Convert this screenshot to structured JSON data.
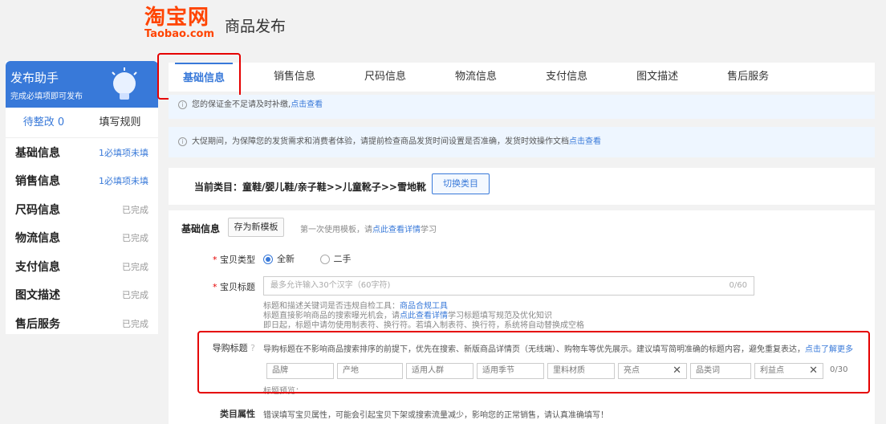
{
  "header": {
    "logo_main": "淘宝网",
    "logo_sub": "Taobao.com",
    "title": "商品发布"
  },
  "sidebar": {
    "title": "发布助手",
    "subtitle": "完成必填项即可发布",
    "icon": "lightbulb-icon",
    "tabs": [
      {
        "label": "待整改 0"
      },
      {
        "label": "填写规则"
      }
    ],
    "items": [
      {
        "label": "基础信息",
        "status": "1必填项未填"
      },
      {
        "label": "销售信息",
        "status": "1必填项未填"
      },
      {
        "label": "尺码信息",
        "status": "已完成"
      },
      {
        "label": "物流信息",
        "status": "已完成"
      },
      {
        "label": "支付信息",
        "status": "已完成"
      },
      {
        "label": "图文描述",
        "status": "已完成"
      },
      {
        "label": "售后服务",
        "status": "已完成"
      }
    ]
  },
  "main_tabs": [
    {
      "label": "基础信息"
    },
    {
      "label": "销售信息"
    },
    {
      "label": "尺码信息"
    },
    {
      "label": "物流信息"
    },
    {
      "label": "支付信息"
    },
    {
      "label": "图文描述"
    },
    {
      "label": "售后服务"
    }
  ],
  "notices": {
    "n1_text": "您的保证金不足请及时补缴,",
    "n1_link": "点击查看",
    "n2_text": "大促期间，为保障您的发货需求和消费者体验，请提前检查商品发货时间设置是否准确，发货时效操作文档",
    "n2_link": "点击查看"
  },
  "category": {
    "label": "当前类目：童鞋/婴儿鞋/亲子鞋>>儿童靴子>>雪地靴",
    "switch_button": "切换类目"
  },
  "form": {
    "section_title": "基础信息",
    "save_template_button": "存为新模板",
    "template_tip_prefix": "第一次使用模板，请",
    "template_tip_link": "点此查看详情",
    "template_tip_suffix": "学习",
    "type_label": "宝贝类型",
    "type_options": [
      "全新",
      "二手"
    ],
    "title_label": "宝贝标题",
    "title_placeholder": "最多允许输入30个汉字（60字符)",
    "title_count": "0/60",
    "title_help1_prefix": "标题和描述关键词是否违规自检工具：",
    "title_help1_link": "商品合规工具",
    "title_help2_prefix": "标题直接影响商品的搜索曝光机会，请",
    "title_help2_link": "点此查看详情",
    "title_help2_suffix": "学习标题填写规范及优化知识",
    "title_help3": "即日起，标题中请勿使用制表符、换行符。若填入制表符、换行符，系统将自动替换成空格",
    "guide_label": "导购标题",
    "guide_desc": "导购标题在不影响商品搜索排序的前提下，优先在搜索、新版商品详情页（无线端）、购物车等优先展示。建议填写简明准确的标题内容，避免重复表达，",
    "guide_link": "点击了解更多",
    "guide_keywords": [
      "品牌",
      "产地",
      "适用人群",
      "适用季节",
      "里料材质",
      "亮点",
      "品类词",
      "利益点"
    ],
    "guide_count": "0/30",
    "guide_preview": "标题预览：",
    "attr_label": "类目属性",
    "attr_desc": "错误填写宝贝属性，可能会引起宝贝下架或搜索流量减少，影响您的正常销售，请认真准确填写！"
  },
  "colors": {
    "brand": "#ff4400",
    "accent": "#3879d9",
    "highlight_box": "#e50000"
  }
}
